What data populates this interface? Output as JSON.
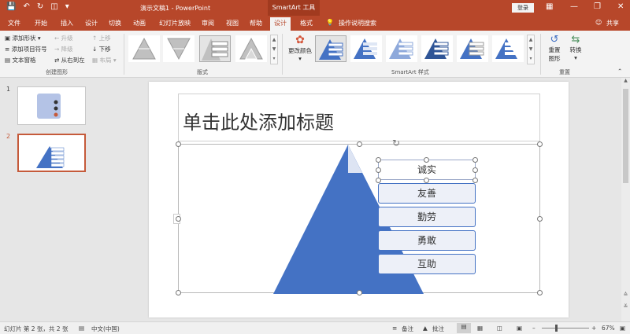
{
  "titlebar": {
    "doc_title": "演示文稿1  -  PowerPoint",
    "context_tab": "SmartArt 工具",
    "login_label": "登录",
    "accent": "#b7472a"
  },
  "tabs": [
    {
      "label": "文件"
    },
    {
      "label": "开始"
    },
    {
      "label": "插入"
    },
    {
      "label": "设计"
    },
    {
      "label": "切换"
    },
    {
      "label": "动画"
    },
    {
      "label": "幻灯片放映"
    },
    {
      "label": "审阅"
    },
    {
      "label": "视图"
    },
    {
      "label": "帮助"
    },
    {
      "label": "设计",
      "active": true
    },
    {
      "label": "格式"
    }
  ],
  "tell_me": "操作说明搜索",
  "share_label": "共享",
  "ribbon": {
    "create": {
      "add_shape": "添加形状",
      "add_bullet": "添加项目符号",
      "text_pane": "文本窗格",
      "promote": "升级",
      "demote": "降级",
      "right_to_left": "从右到左",
      "move_up": "上移",
      "move_down": "下移",
      "layout": "布局",
      "group_label": "创建图形"
    },
    "layouts": {
      "group_label": "版式"
    },
    "styles": {
      "change_colors": "更改颜色",
      "group_label": "SmartArt 样式"
    },
    "reset": {
      "reset_graphic_1": "重置",
      "reset_graphic_2": "图形",
      "convert": "转换",
      "group_label": "重置"
    }
  },
  "slides_pane": {
    "numbers": [
      "1",
      "2"
    ]
  },
  "slide": {
    "title_placeholder": "单击此处添加标题",
    "pyramid_items": [
      "诚实",
      "友善",
      "勤劳",
      "勇敢",
      "互助"
    ],
    "pyramid_color": "#4472c4"
  },
  "status": {
    "slide_info": "幻灯片 第 2 张，共 2 张",
    "language": "中文(中国)",
    "notes": "备注",
    "comments": "批注",
    "zoom": "67%"
  }
}
